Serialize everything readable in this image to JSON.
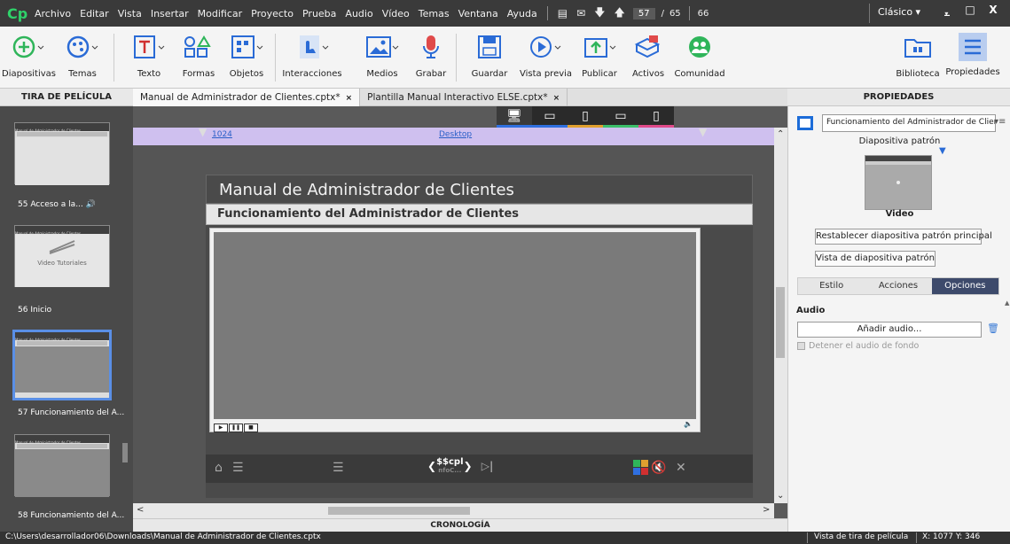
{
  "app": {
    "logo": "Cp"
  },
  "menu": {
    "items": [
      "Archivo",
      "Editar",
      "Vista",
      "Insertar",
      "Modificar",
      "Proyecto",
      "Prueba",
      "Audio",
      "Vídeo",
      "Temas",
      "Ventana",
      "Ayuda"
    ],
    "current_slide": "57",
    "slash": "/",
    "total_slides": "65",
    "extra_number": "66",
    "workspace": "Clásico",
    "minimize": "_",
    "maximize": "□",
    "close": "X"
  },
  "toolbar": {
    "diapositivas": "Diapositivas",
    "temas": "Temas",
    "texto": "Texto",
    "formas": "Formas",
    "objetos": "Objetos",
    "interacciones": "Interacciones",
    "medios": "Medios",
    "grabar": "Grabar",
    "guardar": "Guardar",
    "vista_previa": "Vista previa",
    "publicar": "Publicar",
    "activos": "Activos",
    "comunidad": "Comunidad",
    "biblioteca": "Biblioteca",
    "propiedades": "Propiedades"
  },
  "filmstrip": {
    "header": "TIRA DE PELÍCULA",
    "slides": [
      {
        "label": "55 Acceso a la...",
        "thumb_title": "Manual de Administrador de Clientes",
        "audio": "🔊"
      },
      {
        "label": "56 Inicio",
        "thumb_title": "Manual de Administrador de Clientes",
        "thumb_text": "Video Tutoriales"
      },
      {
        "label": "57 Funcionamiento del A...",
        "thumb_title": "Manual de Administrador de Clientes"
      },
      {
        "label": "58 Funcionamiento del A...",
        "thumb_title": "Manual de Administrador de Clientes"
      }
    ]
  },
  "tabs": [
    {
      "label": "Manual de Administrador de Clientes.cptx*",
      "close": "×",
      "active": true
    },
    {
      "label": "Plantilla Manual Interactivo ELSE.cptx*",
      "close": "×",
      "active": false
    }
  ],
  "stage": {
    "breakpoint_value": "1024",
    "breakpoint_name": "Desktop",
    "device_colors": [
      "#2f6fe0",
      "#2f6fe0",
      "#e0a02f",
      "#3bbf6a",
      "#e04a8a"
    ],
    "slide_title": "Manual de Administrador de Clientes",
    "slide_subtitle": "Funcionamiento del Administrador de Clientes",
    "playbar_center": "$$cpl",
    "playbar_center_sub": "nfoC..."
  },
  "timeline": {
    "header": "CRONOLOGÍA"
  },
  "properties": {
    "header": "PROPIEDADES",
    "slide_name": "Funcionamiento del Administrador de Clientes",
    "master_label": "Diapositiva patrón",
    "master_name": "Video",
    "reset_master": "Restablecer diapositiva patrón principal",
    "view_master": "Vista de diapositiva patrón",
    "tabs": [
      "Estilo",
      "Acciones",
      "Opciones"
    ],
    "active_tab": "Opciones",
    "audio_head": "Audio",
    "add_audio": "Añadir audio...",
    "stop_bg_audio": "Detener el audio de fondo"
  },
  "status": {
    "path": "C:\\Users\\desarrollador06\\Downloads\\Manual de Administrador de Clientes.cptx",
    "view": "Vista de tira de película",
    "coords": "X: 1077 Y: 346"
  },
  "colors": {
    "accent_blue": "#2f6fe0",
    "menubar_bg": "#3a3a3a",
    "stage_bg": "#5a5a5a",
    "breakpoint_bar": "#cfc0ef",
    "active_tab_bg": "#3d4a6b",
    "logo_green": "#2fd26a"
  }
}
